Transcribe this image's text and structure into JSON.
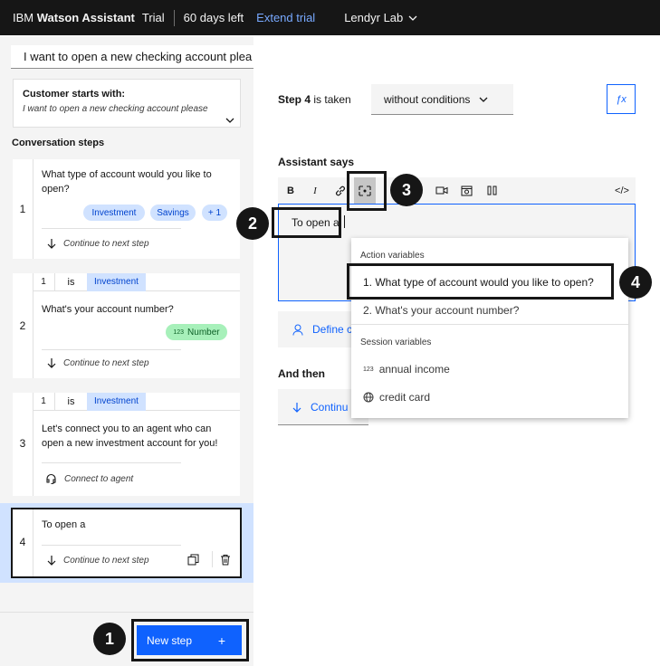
{
  "topbar": {
    "brand_ibm": "IBM",
    "brand_product": "Watson Assistant",
    "trial": "Trial",
    "days_left": "60 days left",
    "extend": "Extend trial",
    "project": "Lendyr Lab"
  },
  "sidebar": {
    "input_value": "I want to open a new checking account plea",
    "starts_title": "Customer starts with:",
    "starts_text": "I want to open a new checking account please",
    "steps_title": "Conversation steps",
    "steps": [
      {
        "number": "1",
        "text": "What type of account would you like to open?",
        "tags": [
          "Investment",
          "Savings",
          "+ 1"
        ],
        "footer": "Continue to next step"
      },
      {
        "number": "2",
        "condition": {
          "step": "1",
          "op": "is",
          "value": "Investment"
        },
        "text": "What's your account number?",
        "tag": "Number",
        "footer": "Continue to next step"
      },
      {
        "number": "3",
        "condition": {
          "step": "1",
          "op": "is",
          "value": "Investment"
        },
        "text": "Let's connect you to an agent who can open a new investment account for you!",
        "footer": "Connect to agent"
      },
      {
        "number": "4",
        "text": "To open a",
        "footer": "Continue to next step"
      }
    ],
    "new_step": "New step",
    "new_step_plus": "+"
  },
  "main": {
    "step_label": "Step 4",
    "step_suffix": "is taken",
    "condition_select": "without conditions",
    "fx": "ƒx",
    "assistant_says": "Assistant says",
    "toolbar": {
      "bold": "B",
      "italic": "I",
      "code": "</>"
    },
    "editor_text": "To open a",
    "define": "Define c",
    "and_then": "And then",
    "continue": "Continu"
  },
  "dropdown": {
    "action_header": "Action variables",
    "action_items": [
      "1. What type of account would you like to open?",
      "2. What's your account number?"
    ],
    "session_header": "Session variables",
    "session_items": [
      "annual income",
      "credit card"
    ],
    "session_badge": "123"
  },
  "callouts": [
    "1",
    "2",
    "3",
    "4"
  ],
  "colors": {
    "brand_blue": "#0f62fe",
    "tag_bg": "#d0e2ff",
    "tag_text": "#0043ce",
    "number_tag_bg": "#a7f0ba",
    "dark": "#161616"
  }
}
